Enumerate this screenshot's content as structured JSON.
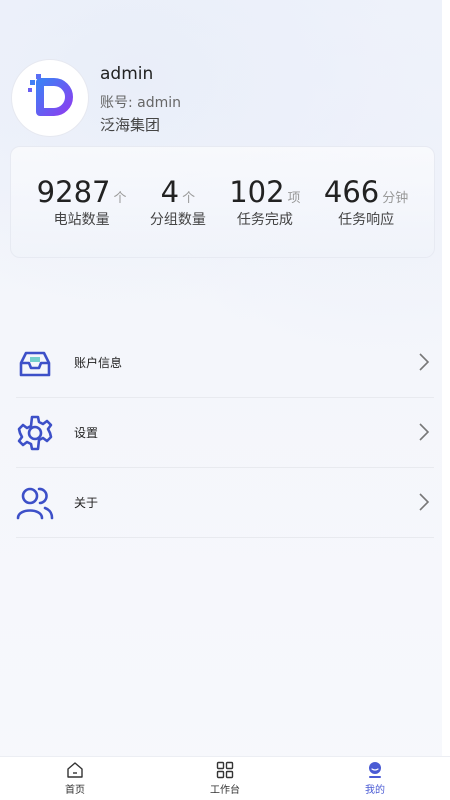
{
  "profile": {
    "username": "admin",
    "account": "账号: admin",
    "company": "泛海集团"
  },
  "stats": [
    {
      "value": "9287",
      "unit": "个",
      "label": "电站数量"
    },
    {
      "value": "4",
      "unit": "个",
      "label": "分组数量"
    },
    {
      "value": "102",
      "unit": "项",
      "label": "任务完成"
    },
    {
      "value": "466",
      "unit": "分钟",
      "label": "任务响应"
    }
  ],
  "menu": [
    {
      "label": "账户信息",
      "icon": "inbox-icon"
    },
    {
      "label": "设置",
      "icon": "gear-icon"
    },
    {
      "label": "关于",
      "icon": "users-icon"
    }
  ],
  "tabbar": [
    {
      "label": "首页",
      "icon": "home-icon",
      "active": false
    },
    {
      "label": "工作台",
      "icon": "grid-icon",
      "active": false
    },
    {
      "label": "我的",
      "icon": "user-icon",
      "active": true
    }
  ],
  "colors": {
    "accent": "#4a5bd4",
    "icon_blue": "#3d50c8",
    "logo_purple": "#7b4cf0"
  }
}
